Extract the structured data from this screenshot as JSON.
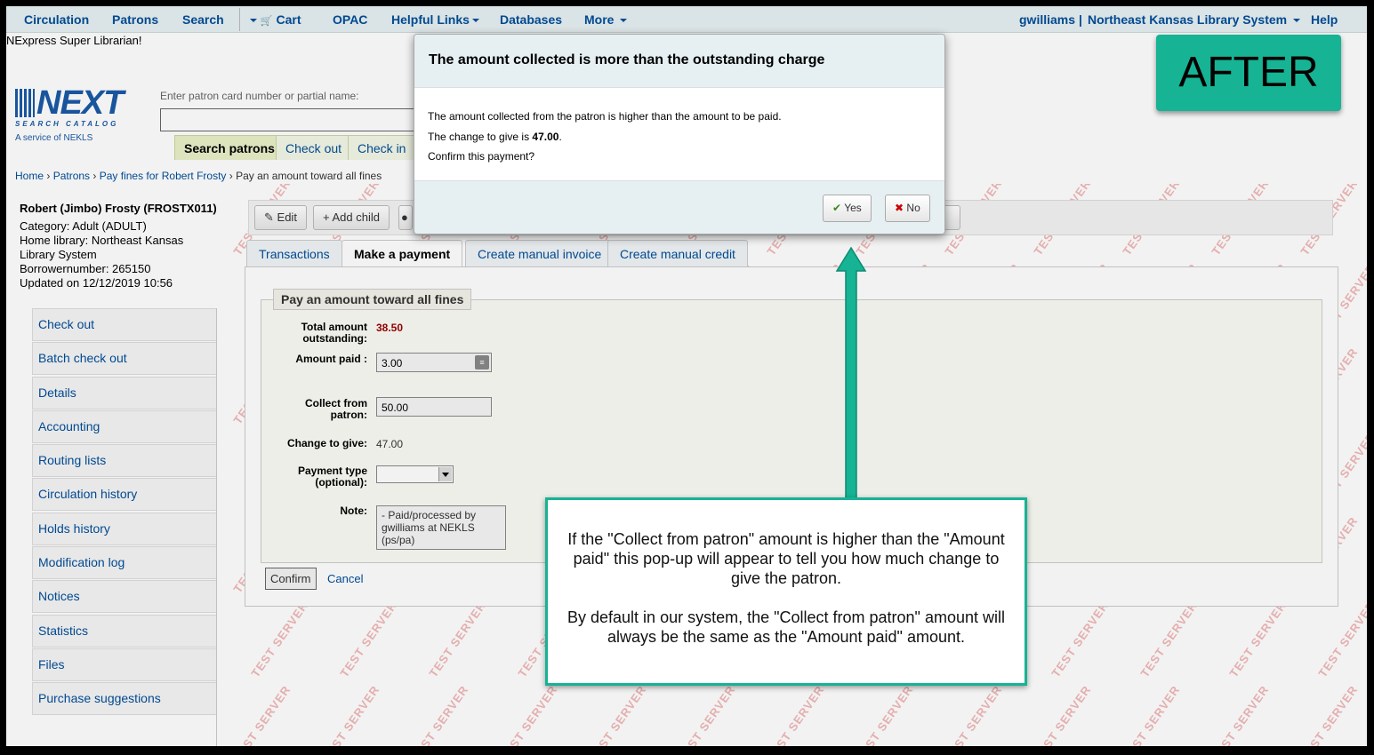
{
  "topnav": {
    "items": [
      "Circulation",
      "Patrons",
      "Search",
      "Cart",
      "OPAC",
      "Helpful Links",
      "Databases",
      "More"
    ],
    "user": "gwilliams",
    "library": "Northeast Kansas Library System",
    "help": "Help"
  },
  "welcome": "NExpress Super Librarian!",
  "logo": {
    "name": "NEXT",
    "subtitle": "SEARCH CATALOG",
    "service": "A service of NEKLS"
  },
  "patron_search": {
    "label": "Enter patron card number or partial name:",
    "tabs": [
      "Search patrons",
      "Check out",
      "Check in"
    ]
  },
  "breadcrumb": {
    "items": [
      "Home",
      "Patrons",
      "Pay fines for Robert Frosty"
    ],
    "current": "Pay an amount toward all fines"
  },
  "patron": {
    "name": "Robert (Jimbo) Frosty (FROSTX011)",
    "category": "Category: Adult (ADULT)",
    "home_library": "Home library: Northeast Kansas Library System",
    "borrowernumber": "Borrowernumber: 265150",
    "updated": "Updated on 12/12/2019 10:56"
  },
  "side_menu": [
    "Check out",
    "Batch check out",
    "Details",
    "Accounting",
    "Routing lists",
    "Circulation history",
    "Holds history",
    "Modification log",
    "Notices",
    "Statistics",
    "Files",
    "Purchase suggestions"
  ],
  "toolbar": {
    "edit": "Edit",
    "add_child": "Add child"
  },
  "tabs": [
    "Transactions",
    "Make a payment",
    "Create manual invoice",
    "Create manual credit"
  ],
  "form": {
    "legend": "Pay an amount toward all fines",
    "total_label": "Total amount outstanding:",
    "total_value": "38.50",
    "amount_paid_label": "Amount paid :",
    "amount_paid_value": "3.00",
    "collect_label": "Collect from patron:",
    "collect_value": "50.00",
    "change_label": "Change to give:",
    "change_value": "47.00",
    "payment_type_label": "Payment type (optional):",
    "note_label": "Note:",
    "note_value": "- Paid/processed by gwilliams at NEKLS (ps/pa)",
    "confirm": "Confirm",
    "cancel": "Cancel"
  },
  "modal": {
    "title": "The amount collected is more than the outstanding charge",
    "line1": "The amount collected from the patron is higher than the amount to be paid.",
    "line2_prefix": "The change to give is ",
    "line2_amount": "47.00",
    "line2_suffix": ".",
    "line3": "Confirm this payment?",
    "yes": "Yes",
    "no": "No"
  },
  "watermark": "TEST SERVER",
  "badge": "AFTER",
  "callout": {
    "p1": "If the \"Collect from patron\" amount is higher than the \"Amount paid\" this pop-up will appear to tell you how much change to give the patron.",
    "p2": "By default in our system, the \"Collect from patron\" amount will always be the same as the \"Amount paid\" amount."
  },
  "colors": {
    "accent": "#16b394",
    "link": "#004d99",
    "amount_due": "#990000"
  }
}
